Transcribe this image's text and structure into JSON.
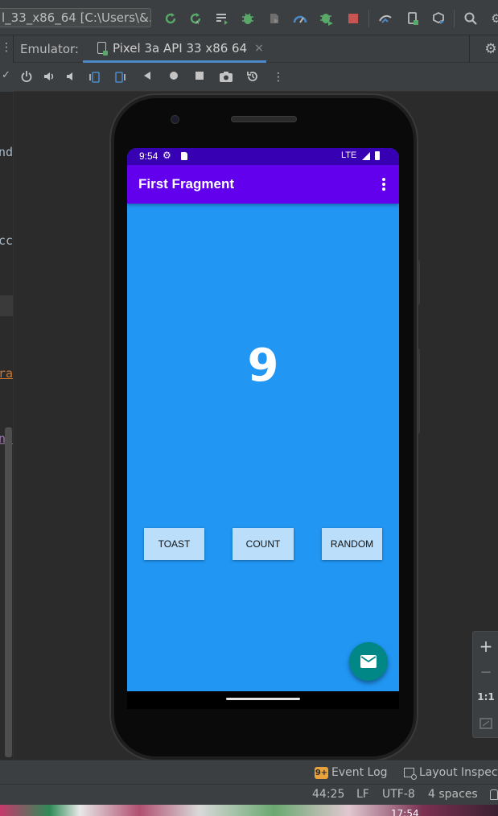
{
  "ide": {
    "run_config": "l_33_x86_64 [C:\\Users\\&...",
    "toolbar_icons": [
      "rerun-icon",
      "apply-changes-icon",
      "apply-code-changes-icon",
      "debug-icon",
      "attach-debugger-icon",
      "profiler-icon",
      "coverage-icon",
      "stop-icon",
      "sync-gradle-icon",
      "device-manager-icon",
      "sdk-manager-icon",
      "search-icon",
      "settings-icon"
    ],
    "stop_color": "#c75450",
    "accent_green": "#59a869"
  },
  "emulator_tabs": {
    "label": "Emulator:",
    "device_tab": "Pixel 3a API 33 x86 64",
    "close": "×"
  },
  "controls": [
    "power-icon",
    "volume-up-icon",
    "volume-down-icon",
    "rotate-left-icon",
    "rotate-right-icon",
    "back-icon",
    "home-icon",
    "overview-icon",
    "screenshot-icon",
    "snapshot-icon",
    "more-icon"
  ],
  "left_editor": {
    "fragments": [
      "nd",
      "cc",
      "ra",
      "nt"
    ]
  },
  "device": {
    "status_bar": {
      "time": "9:54",
      "network": "LTE"
    },
    "app_bar": {
      "title": "First Fragment"
    },
    "count": "9",
    "buttons": {
      "toast": "TOAST",
      "count": "COUNT",
      "random": "RANDOM"
    },
    "colors": {
      "primary": "#6200ee",
      "primary_dark": "#3700b3",
      "background": "#2196f3",
      "button": "#bbdefb",
      "fab": "#018786"
    }
  },
  "zoom": {
    "in": "+",
    "out": "−",
    "actual": "1:1"
  },
  "bottom_bar": {
    "event_log_badge": "9+",
    "event_log": "Event Log",
    "layout_inspector": "Layout Inspecto"
  },
  "status": {
    "position": "44:25",
    "line_sep": "LF",
    "encoding": "UTF-8",
    "indent": "4 spaces"
  },
  "taskbar": {
    "clock": "17:54"
  }
}
